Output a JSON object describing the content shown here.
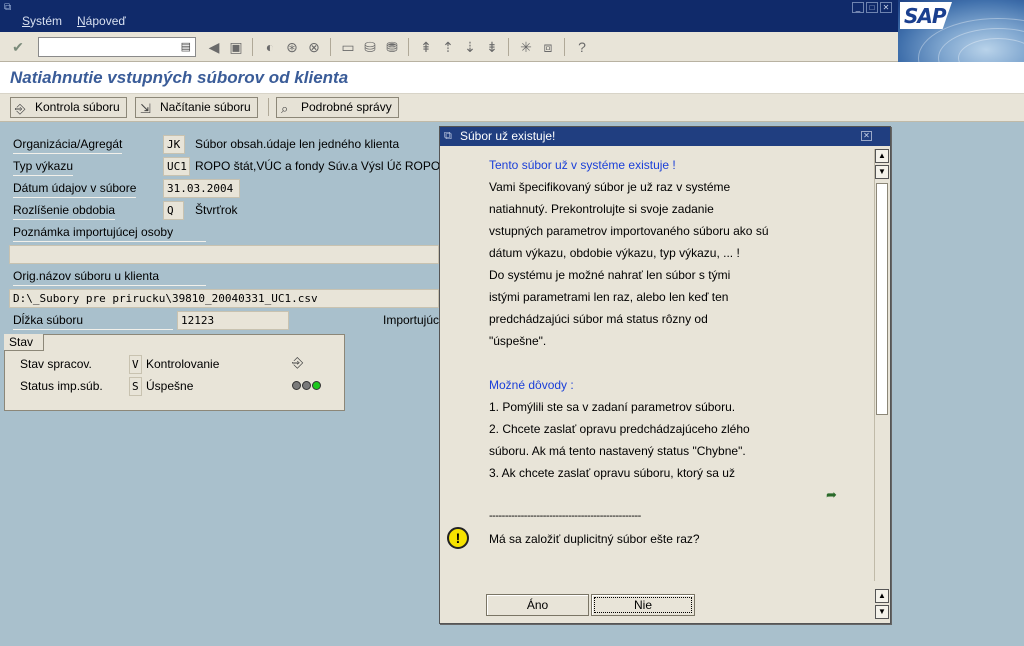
{
  "menubar": {
    "items": [
      "Systém",
      "Nápoveď"
    ],
    "logo": "SAP"
  },
  "toolbar": {
    "command_value": ""
  },
  "page": {
    "title": "Natiahnutie vstupných súborov od klienta"
  },
  "app_toolbar": {
    "buttons": [
      "Kontrola súboru",
      "Načítanie súboru",
      "Podrobné správy"
    ]
  },
  "form": {
    "org_label": "Organizácia/Agregát",
    "org_value": "JK",
    "org_text": "Súbor obsah.údaje len jedného klienta",
    "typ_label": "Typ výkazu",
    "typ_value": "UC1",
    "typ_text": "ROPO štát,VÚC a fondy Súv.a Výsl Úč ROPO",
    "datum_label": "Dátum údajov v súbore",
    "datum_value": "31.03.2004",
    "rozlisenie_label": "Rozlíšenie obdobia",
    "rozlisenie_value": "Q",
    "rozlisenie_text": "Štvrťrok",
    "poznamka_label": "Poznámka importujúcej osoby",
    "poznamka_value": "",
    "orig_label": "Orig.názov súboru u klienta",
    "orig_value": "D:\\_Subory pre prirucku\\39810_20040331_UC1.csv",
    "dlzka_label": "Dĺžka súboru",
    "dlzka_value": "12123",
    "importuj_label": "Importujúc"
  },
  "stav": {
    "tab": "Stav",
    "spracov_label": "Stav spracov.",
    "spracov_value": "V",
    "spracov_text": "Kontrolovanie",
    "imp_label": "Status imp.súb.",
    "imp_value": "S",
    "imp_text": "Úspešne"
  },
  "dialog": {
    "title": "Súbor už existuje!",
    "heading": "Tento súbor už v systéme existuje !",
    "lines": [
      "Vami špecifikovaný súbor je už raz v systéme",
      "natiahnutý. Prekontrolujte si svoje zadanie",
      "vstupných parametrov importovaného súboru ako sú",
      "dátum výkazu, obdobie výkazu, typ výkazu, ...  !",
      "Do systému je možné nahrať len súbor s tými",
      "istými parametrami len raz, alebo len keď ten",
      "predchádzajúci súbor má status rôzny od",
      "\"úspešne\"."
    ],
    "reasons_heading": "Možné dôvody :",
    "reasons": [
      "1. Pomýlili ste sa v zadaní parametrov súboru.",
      "2. Chcete zaslať opravu predchádzajúceho zlého",
      "súboru. Ak má tento nastavený status \"Chybne\".",
      "3. Ak chcete zaslať opravu súboru, ktorý sa už"
    ],
    "separator": "------------------------------------------------",
    "question": "Má sa založiť duplicitný súbor ešte raz?",
    "yes_label": "Áno",
    "no_label": "Nie"
  }
}
